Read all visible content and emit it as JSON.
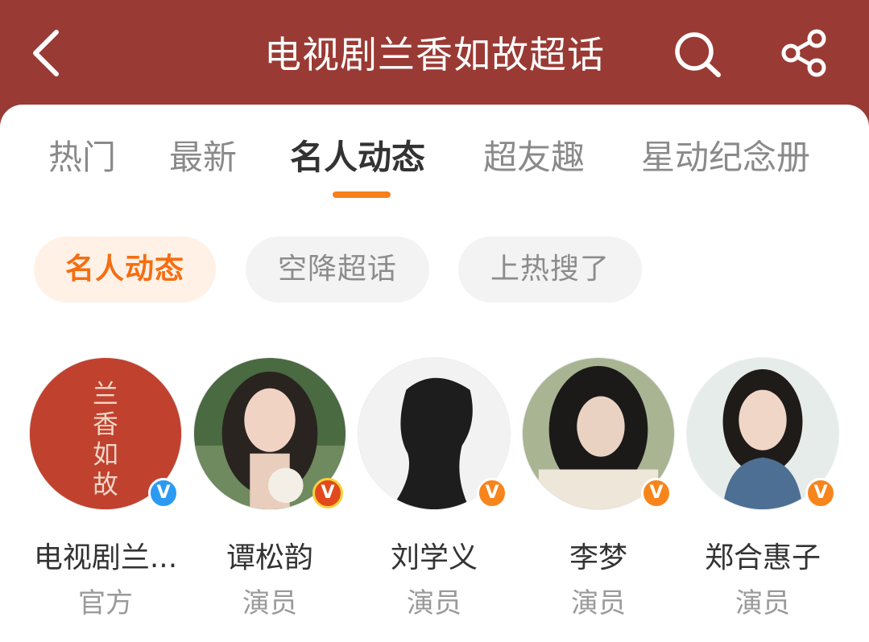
{
  "header": {
    "title": "电视剧兰香如故超话",
    "back_icon": "chevron-left-icon",
    "search_icon": "search-icon",
    "share_icon": "share-icon",
    "background_color": "#9a3a34"
  },
  "tabs": [
    {
      "label": "热门",
      "active": false
    },
    {
      "label": "最新",
      "active": false
    },
    {
      "label": "名人动态",
      "active": true
    },
    {
      "label": "超友趣",
      "active": false
    },
    {
      "label": "星动纪念册",
      "active": false
    }
  ],
  "accent_color": "#f77f1c",
  "filters": [
    {
      "label": "名人动态",
      "active": true
    },
    {
      "label": "空降超话",
      "active": false
    },
    {
      "label": "上热搜了",
      "active": false
    }
  ],
  "celebrities": [
    {
      "name": "电视剧兰...",
      "role": "官方",
      "avatar_text": "兰香如故",
      "badge": "blue"
    },
    {
      "name": "谭松韵",
      "role": "演员",
      "badge": "gold"
    },
    {
      "name": "刘学义",
      "role": "演员",
      "badge": "orange"
    },
    {
      "name": "李梦",
      "role": "演员",
      "badge": "orange"
    },
    {
      "name": "郑合惠子",
      "role": "演员",
      "badge": "orange"
    }
  ]
}
